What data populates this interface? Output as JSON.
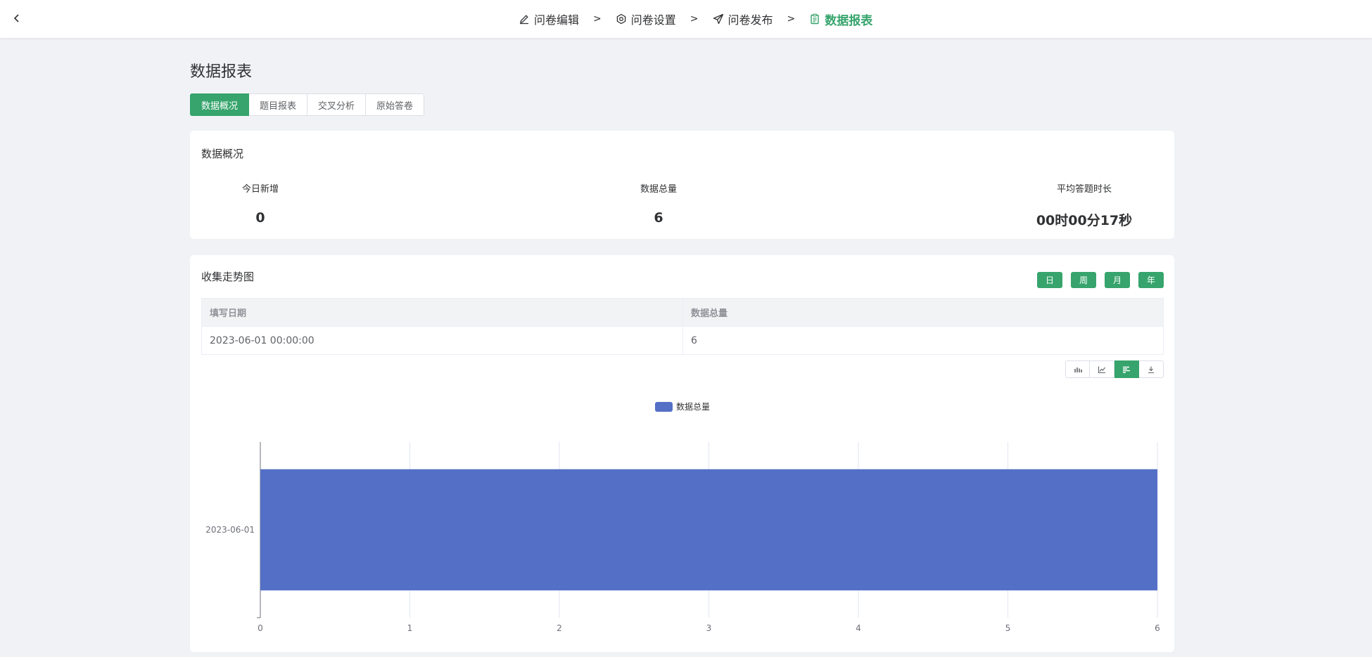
{
  "steps": [
    {
      "label": "问卷编辑",
      "icon": "edit-icon"
    },
    {
      "label": "问卷设置",
      "icon": "gear-icon"
    },
    {
      "label": "问卷发布",
      "icon": "send-icon"
    },
    {
      "label": "数据报表",
      "icon": "clipboard-icon",
      "active": true
    }
  ],
  "step_separator": ">",
  "page_title": "数据报表",
  "tabs": [
    "数据概况",
    "题目报表",
    "交叉分析",
    "原始答卷"
  ],
  "overview": {
    "title": "数据概况",
    "stats": [
      {
        "label": "今日新增",
        "value": "0"
      },
      {
        "label": "数据总量",
        "value": "6"
      },
      {
        "label": "平均答题时长",
        "value": "00时00分17秒"
      }
    ]
  },
  "trend": {
    "title": "收集走势图",
    "periods": [
      "日",
      "周",
      "月",
      "年"
    ],
    "table": {
      "headers": [
        "填写日期",
        "数据总量"
      ],
      "rows": [
        [
          "2023-06-01 00:00:00",
          "6"
        ]
      ]
    },
    "chart_tools": [
      "bar-chart-icon",
      "line-chart-icon",
      "horizontal-bar-icon",
      "download-icon"
    ],
    "active_tool": 2
  },
  "colors": {
    "accent": "#36a46c",
    "bar": "#5470c6"
  },
  "chart_data": {
    "type": "bar",
    "orientation": "horizontal",
    "categories": [
      "2023-06-01"
    ],
    "series": [
      {
        "name": "数据总量",
        "values": [
          6
        ]
      }
    ],
    "xlim": [
      0,
      6
    ],
    "xticks": [
      "0",
      "1",
      "2",
      "3",
      "4",
      "5",
      "6"
    ],
    "legend": "top-center",
    "grid": true
  }
}
